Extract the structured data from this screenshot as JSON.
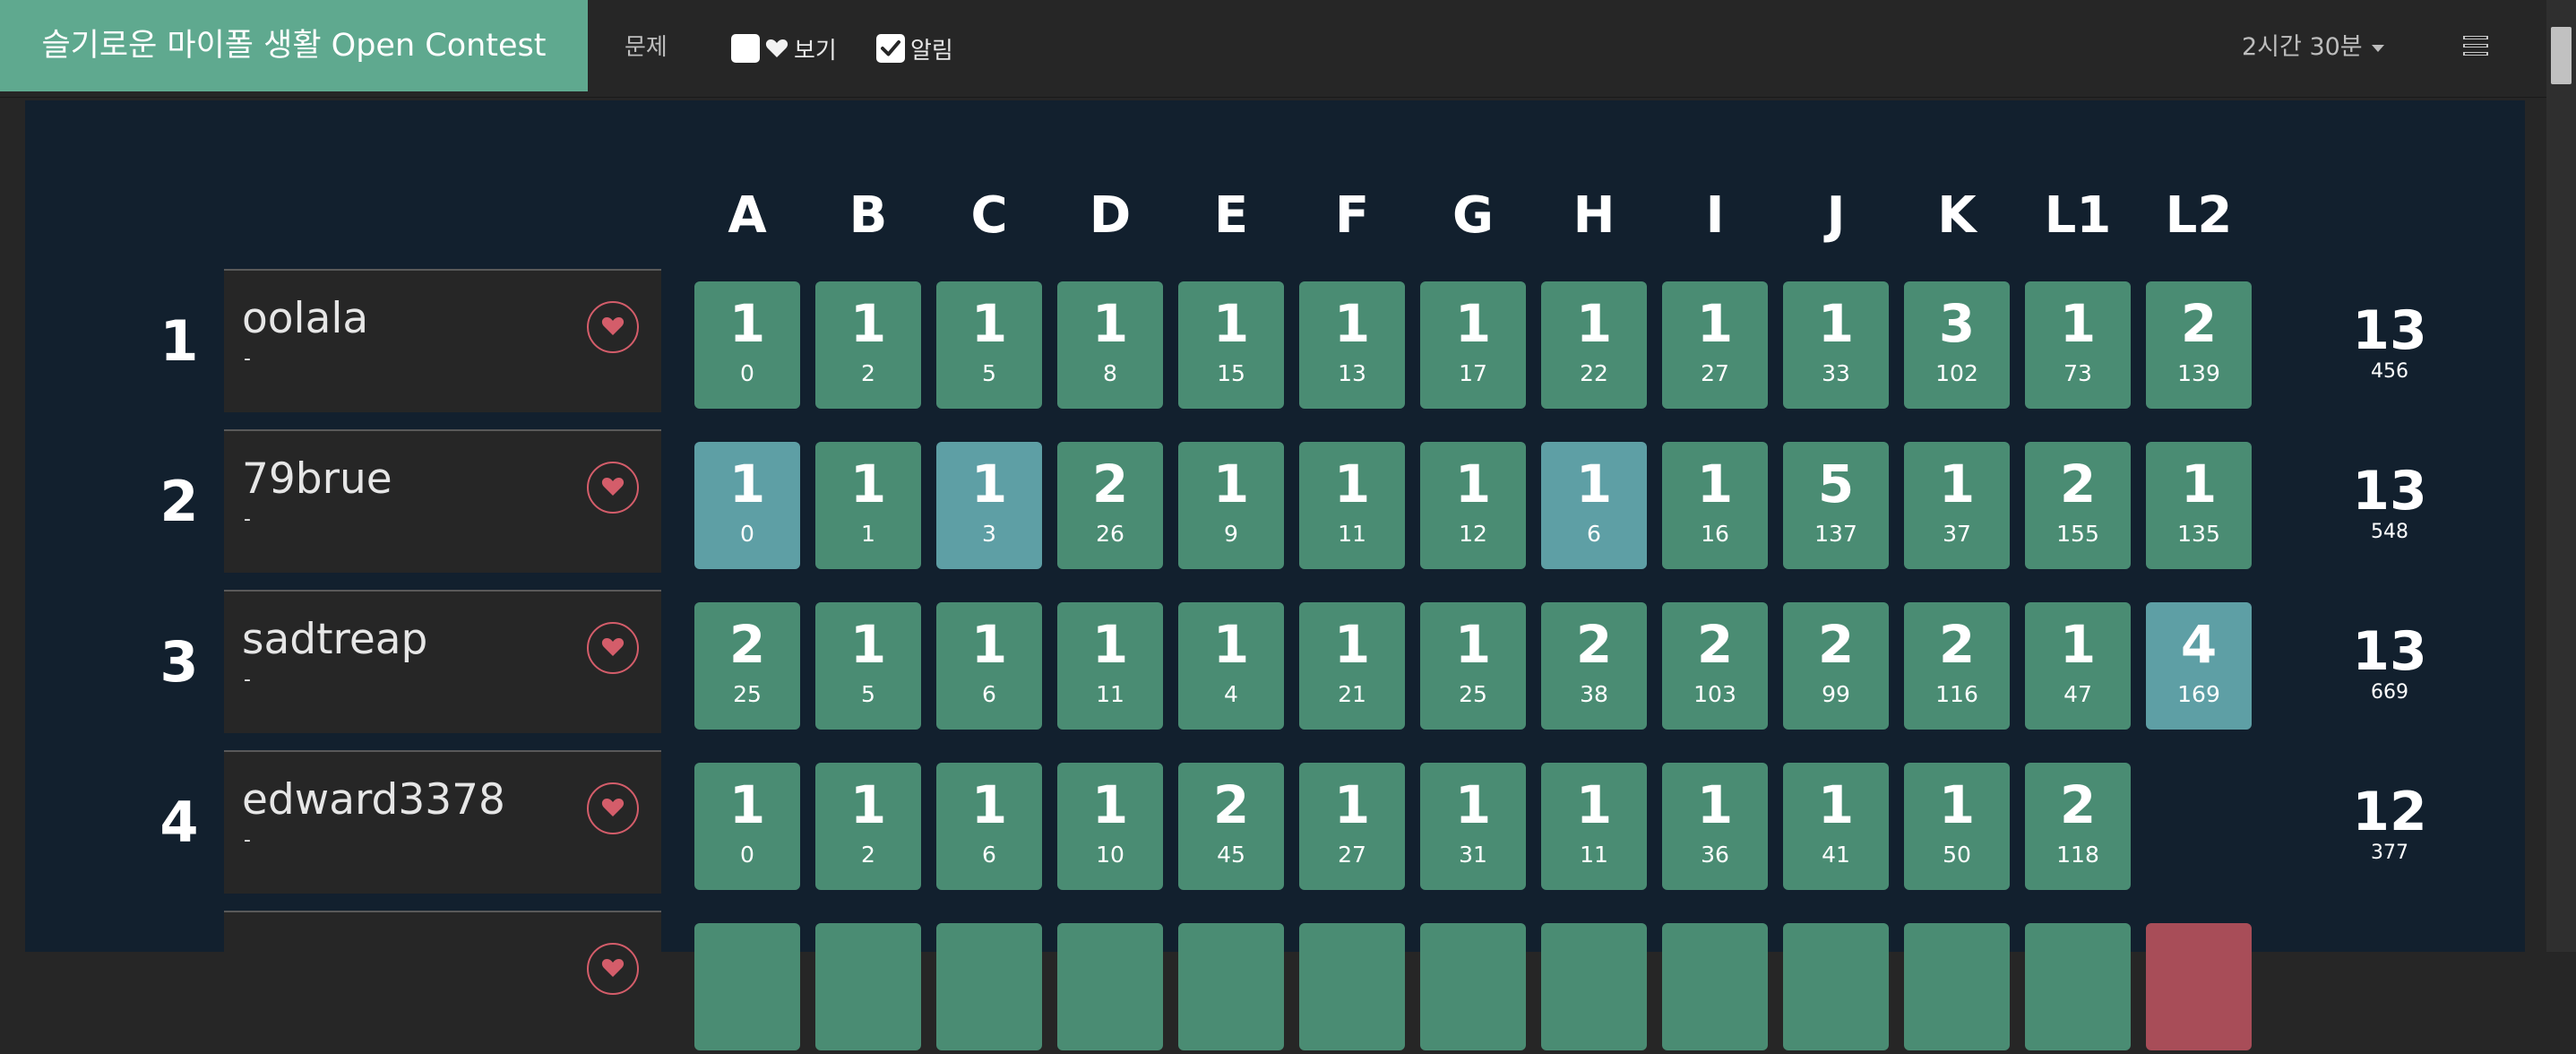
{
  "header": {
    "contest_title": "슬기로운 마이폴 생활 Open Contest",
    "problems_link": "문제",
    "hearts_toggle": {
      "label": "보기",
      "checked": false,
      "icon": "heart-icon"
    },
    "alert_toggle": {
      "label": "알림",
      "checked": true
    },
    "timer": "2시간 30분",
    "menu_icon": "list-icon"
  },
  "colors": {
    "accent": "#5fa98f",
    "solved": "#4a8c73",
    "first_solve": "#5e9fa5",
    "wrong": "#a84d58",
    "board_bg": "#12202e"
  },
  "problems": [
    "A",
    "B",
    "C",
    "D",
    "E",
    "F",
    "G",
    "H",
    "I",
    "J",
    "K",
    "L1",
    "L2"
  ],
  "rows": [
    {
      "rank": "1",
      "user": "oolala",
      "sub": "-",
      "cells": [
        {
          "tries": "1",
          "time": "0",
          "status": "solved"
        },
        {
          "tries": "1",
          "time": "2",
          "status": "solved"
        },
        {
          "tries": "1",
          "time": "5",
          "status": "solved"
        },
        {
          "tries": "1",
          "time": "8",
          "status": "solved"
        },
        {
          "tries": "1",
          "time": "15",
          "status": "solved"
        },
        {
          "tries": "1",
          "time": "13",
          "status": "solved"
        },
        {
          "tries": "1",
          "time": "17",
          "status": "solved"
        },
        {
          "tries": "1",
          "time": "22",
          "status": "solved"
        },
        {
          "tries": "1",
          "time": "27",
          "status": "solved"
        },
        {
          "tries": "1",
          "time": "33",
          "status": "solved"
        },
        {
          "tries": "3",
          "time": "102",
          "status": "solved"
        },
        {
          "tries": "1",
          "time": "73",
          "status": "solved"
        },
        {
          "tries": "2",
          "time": "139",
          "status": "solved"
        }
      ],
      "solved": "13",
      "penalty": "456"
    },
    {
      "rank": "2",
      "user": "79brue",
      "sub": "-",
      "cells": [
        {
          "tries": "1",
          "time": "0",
          "status": "first"
        },
        {
          "tries": "1",
          "time": "1",
          "status": "solved"
        },
        {
          "tries": "1",
          "time": "3",
          "status": "first"
        },
        {
          "tries": "2",
          "time": "26",
          "status": "solved"
        },
        {
          "tries": "1",
          "time": "9",
          "status": "solved"
        },
        {
          "tries": "1",
          "time": "11",
          "status": "solved"
        },
        {
          "tries": "1",
          "time": "12",
          "status": "solved"
        },
        {
          "tries": "1",
          "time": "6",
          "status": "first"
        },
        {
          "tries": "1",
          "time": "16",
          "status": "solved"
        },
        {
          "tries": "5",
          "time": "137",
          "status": "solved"
        },
        {
          "tries": "1",
          "time": "37",
          "status": "solved"
        },
        {
          "tries": "2",
          "time": "155",
          "status": "solved"
        },
        {
          "tries": "1",
          "time": "135",
          "status": "solved"
        }
      ],
      "solved": "13",
      "penalty": "548"
    },
    {
      "rank": "3",
      "user": "sadtreap",
      "sub": "-",
      "cells": [
        {
          "tries": "2",
          "time": "25",
          "status": "solved"
        },
        {
          "tries": "1",
          "time": "5",
          "status": "solved"
        },
        {
          "tries": "1",
          "time": "6",
          "status": "solved"
        },
        {
          "tries": "1",
          "time": "11",
          "status": "solved"
        },
        {
          "tries": "1",
          "time": "4",
          "status": "solved"
        },
        {
          "tries": "1",
          "time": "21",
          "status": "solved"
        },
        {
          "tries": "1",
          "time": "25",
          "status": "solved"
        },
        {
          "tries": "2",
          "time": "38",
          "status": "solved"
        },
        {
          "tries": "2",
          "time": "103",
          "status": "solved"
        },
        {
          "tries": "2",
          "time": "99",
          "status": "solved"
        },
        {
          "tries": "2",
          "time": "116",
          "status": "solved"
        },
        {
          "tries": "1",
          "time": "47",
          "status": "solved"
        },
        {
          "tries": "4",
          "time": "169",
          "status": "first"
        }
      ],
      "solved": "13",
      "penalty": "669"
    },
    {
      "rank": "4",
      "user": "edward3378",
      "sub": "-",
      "cells": [
        {
          "tries": "1",
          "time": "0",
          "status": "solved"
        },
        {
          "tries": "1",
          "time": "2",
          "status": "solved"
        },
        {
          "tries": "1",
          "time": "6",
          "status": "solved"
        },
        {
          "tries": "1",
          "time": "10",
          "status": "solved"
        },
        {
          "tries": "2",
          "time": "45",
          "status": "solved"
        },
        {
          "tries": "1",
          "time": "27",
          "status": "solved"
        },
        {
          "tries": "1",
          "time": "31",
          "status": "solved"
        },
        {
          "tries": "1",
          "time": "11",
          "status": "solved"
        },
        {
          "tries": "1",
          "time": "36",
          "status": "solved"
        },
        {
          "tries": "1",
          "time": "41",
          "status": "solved"
        },
        {
          "tries": "1",
          "time": "50",
          "status": "solved"
        },
        {
          "tries": "2",
          "time": "118",
          "status": "solved"
        },
        {
          "tries": "",
          "time": "",
          "status": "empty"
        }
      ],
      "solved": "12",
      "penalty": "377"
    },
    {
      "rank": "",
      "user": "",
      "sub": "",
      "cells": [
        {
          "tries": "",
          "time": "",
          "status": "solved"
        },
        {
          "tries": "",
          "time": "",
          "status": "solved"
        },
        {
          "tries": "",
          "time": "",
          "status": "solved"
        },
        {
          "tries": "",
          "time": "",
          "status": "solved"
        },
        {
          "tries": "",
          "time": "",
          "status": "solved"
        },
        {
          "tries": "",
          "time": "",
          "status": "solved"
        },
        {
          "tries": "",
          "time": "",
          "status": "solved"
        },
        {
          "tries": "",
          "time": "",
          "status": "solved"
        },
        {
          "tries": "",
          "time": "",
          "status": "solved"
        },
        {
          "tries": "",
          "time": "",
          "status": "solved"
        },
        {
          "tries": "",
          "time": "",
          "status": "solved"
        },
        {
          "tries": "",
          "time": "",
          "status": "solved"
        },
        {
          "tries": "",
          "time": "",
          "status": "wrong"
        }
      ],
      "solved": "",
      "penalty": ""
    }
  ]
}
